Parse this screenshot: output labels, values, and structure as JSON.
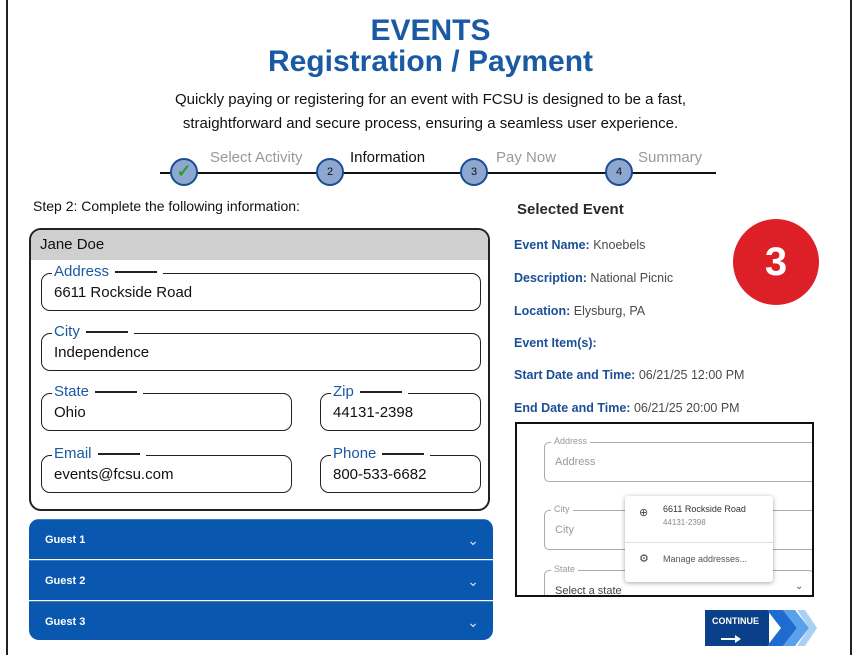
{
  "header": {
    "title": "EVENTS",
    "subtitle": "Registration / Payment",
    "intro_line1": "Quickly paying or registering for an event with FCSU is designed to be a fast,",
    "intro_line2": "straightforward and secure process, ensuring a seamless user experience."
  },
  "steps": [
    {
      "number": "✓",
      "label": "Select Activity",
      "state": "done"
    },
    {
      "number": "2",
      "label": "Information",
      "state": "active"
    },
    {
      "number": "3",
      "label": "Pay Now",
      "state": "pending"
    },
    {
      "number": "4",
      "label": "Summary",
      "state": "pending"
    }
  ],
  "form": {
    "instruction": "Step 2: Complete the following information:",
    "attendee_name": "Jane Doe",
    "address": {
      "label": "Address",
      "value": "6611 Rockside Road"
    },
    "city": {
      "label": "City",
      "value": "Independence"
    },
    "state": {
      "label": "State",
      "value": "Ohio"
    },
    "zip": {
      "label": "Zip",
      "value": "44131-2398"
    },
    "email": {
      "label": "Email",
      "value": "events@fcsu.com"
    },
    "phone": {
      "label": "Phone",
      "value": "800-533-6682"
    }
  },
  "guests": [
    {
      "label": "Guest 1"
    },
    {
      "label": "Guest 2"
    },
    {
      "label": "Guest 3"
    }
  ],
  "selected_event": {
    "title": "Selected Event",
    "name_label": "Event Name:",
    "name_value": "Knoebels",
    "desc_label": "Description:",
    "desc_value": "National Picnic",
    "loc_label": "Location:",
    "loc_value": "Elysburg, PA",
    "items_label": "Event Item(s):",
    "start_label": "Start Date and Time:",
    "start_value": "06/21/25 12:00 PM",
    "end_label": "End Date and Time:",
    "end_value": "06/21/25 20:00 PM"
  },
  "badge": "3",
  "autofill_demo": {
    "address_label": "Address",
    "address_placeholder": "Address",
    "city_label": "City",
    "city_placeholder": "City",
    "state_label": "State",
    "state_placeholder": "Select a state",
    "suggestion_line1": "6611 Rockside Road",
    "suggestion_line2": "44131-2398",
    "manage_label": "Manage addresses..."
  },
  "continue_label": "CONTINUE",
  "colors": {
    "brand_blue": "#1a5aa3",
    "guest_bar": "#0a57b0",
    "badge_red": "#dd2027",
    "done_check": "#2e9b3a"
  }
}
